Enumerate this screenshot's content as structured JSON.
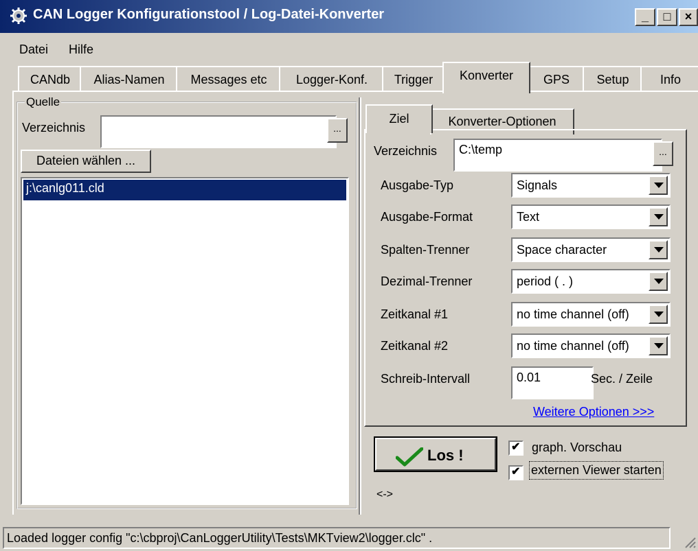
{
  "window": {
    "title": "CAN Logger Konfigurationstool / Log-Datei-Konverter"
  },
  "menu": [
    {
      "label": "Datei"
    },
    {
      "label": "Hilfe"
    }
  ],
  "tabs": [
    {
      "label": "CANdb"
    },
    {
      "label": "Alias-Namen"
    },
    {
      "label": "Messages etc"
    },
    {
      "label": "Logger-Konf."
    },
    {
      "label": "Trigger"
    },
    {
      "label": "Konverter"
    },
    {
      "label": "GPS"
    },
    {
      "label": "Setup"
    },
    {
      "label": "Info"
    }
  ],
  "active_tab": "Konverter",
  "source": {
    "group_label": "Quelle",
    "dir_label": "Verzeichnis",
    "dir_value": "",
    "browse_label": "...",
    "choose_button": "Dateien wählen ...",
    "files": [
      "j:\\canlg011.cld"
    ]
  },
  "target": {
    "tabs": [
      {
        "label": "Ziel"
      },
      {
        "label": "Konverter-Optionen"
      }
    ],
    "dir_label": "Verzeichnis",
    "dir_value": "C:\\temp",
    "browse_label": "...",
    "fields": [
      {
        "label": "Ausgabe-Typ",
        "value": "Signals"
      },
      {
        "label": "Ausgabe-Format",
        "value": "Text"
      },
      {
        "label": "Spalten-Trenner",
        "value": "Space character"
      },
      {
        "label": "Dezimal-Trenner",
        "value": "period ( . )"
      },
      {
        "label": "Zeitkanal #1",
        "value": "no time channel (off)"
      },
      {
        "label": "Zeitkanal #2",
        "value": "no time channel (off)"
      }
    ],
    "interval_label": "Schreib-Intervall",
    "interval_value": "0.01",
    "interval_unit": "Sec. / Zeile",
    "more_link": "Weitere Optionen >>>"
  },
  "actions": {
    "go_button": "Los !",
    "preview_label": "graph. Vorschau",
    "preview_checked": true,
    "viewer_label": "externen Viewer starten",
    "viewer_checked": true,
    "swap_label": "<->"
  },
  "status": "Loaded logger config \"c:\\cbproj\\CanLoggerUtility\\Tests\\MKTview2\\logger.clc\" ."
}
